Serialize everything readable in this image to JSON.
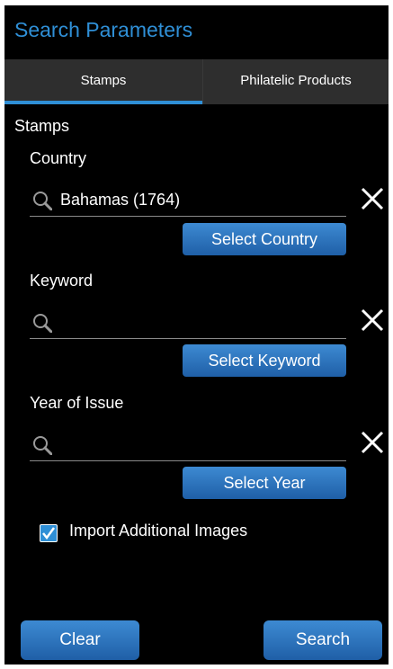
{
  "header": {
    "title": "Search Parameters"
  },
  "tabs": [
    {
      "label": "Stamps",
      "active": true
    },
    {
      "label": "Philatelic Products",
      "active": false
    }
  ],
  "section": {
    "heading": "Stamps"
  },
  "fields": [
    {
      "label": "Country",
      "value": "Bahamas (1764)",
      "button": "Select Country"
    },
    {
      "label": "Keyword",
      "value": "",
      "button": "Select Keyword"
    },
    {
      "label": "Year of Issue",
      "value": "",
      "button": "Select Year"
    }
  ],
  "options": {
    "import_images_label": "Import Additional Images",
    "import_images_checked": true
  },
  "footer": {
    "clear_label": "Clear",
    "search_label": "Search"
  },
  "colors": {
    "accent": "#2f8fd6",
    "background": "#000000",
    "tab_bar": "#2e2e2e",
    "button": "#2a73bf"
  },
  "icons": {
    "search": "search-icon",
    "clear": "close-icon",
    "check": "checkmark-icon"
  }
}
